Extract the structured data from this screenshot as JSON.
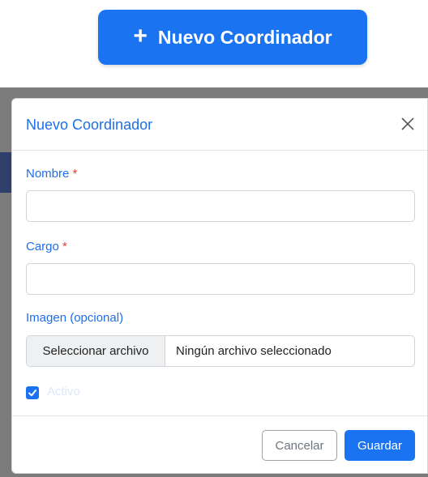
{
  "page": {
    "new_button_label": "Nuevo Coordinador",
    "new_button_icon": "plus-icon"
  },
  "modal": {
    "title": "Nuevo Coordinador",
    "close_icon": "close-icon",
    "fields": {
      "nombre": {
        "label": "Nombre",
        "required_mark": "*",
        "value": ""
      },
      "cargo": {
        "label": "Cargo",
        "required_mark": "*",
        "value": ""
      },
      "imagen": {
        "label": "Imagen (opcional)",
        "button_label": "Seleccionar archivo",
        "status_text": "Ningún archivo seleccionado"
      },
      "activo": {
        "label": "Activo",
        "checked": true
      }
    },
    "footer": {
      "cancel_label": "Cancelar",
      "save_label": "Guardar"
    }
  },
  "colors": {
    "primary": "#1a73f0",
    "title_blue": "#1f6fe8",
    "required_red": "#e03a3a",
    "backdrop": "#7b7b7b"
  }
}
